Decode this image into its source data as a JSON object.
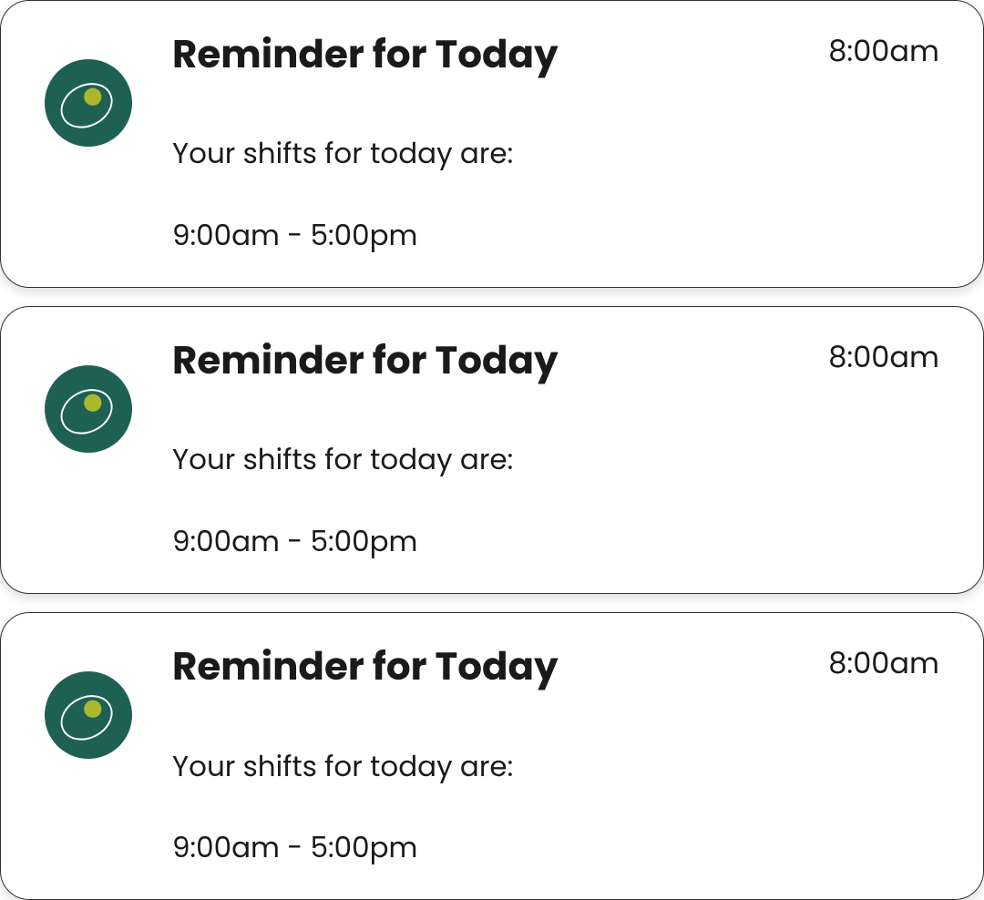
{
  "colors": {
    "icon_bg": "#1f5f55",
    "icon_accent": "#a9b92b",
    "icon_ring": "#ffffff"
  },
  "icon_svg": "<svg viewBox=\"0 0 100 100\"><circle cx=\"50\" cy=\"50\" r=\"50\" fill=\"#1f6055\"/><ellipse cx=\"48\" cy=\"53\" rx=\"30\" ry=\"23\" fill=\"none\" stroke=\"#ffffff\" stroke-width=\"2\" transform=\"rotate(-28 48 53)\"/><circle cx=\"55\" cy=\"43\" r=\"10\" fill=\"#a9b92b\"/></svg>",
  "notifications": [
    {
      "title": "Reminder for Today",
      "time": "8:00am",
      "body_line1": "Your shifts for today are:",
      "body_line2": "9:00am - 5:00pm"
    },
    {
      "title": "Reminder for Today",
      "time": "8:00am",
      "body_line1": "Your shifts for today are:",
      "body_line2": "9:00am - 5:00pm"
    },
    {
      "title": "Reminder for Today",
      "time": "8:00am",
      "body_line1": "Your shifts for today are:",
      "body_line2": "9:00am - 5:00pm"
    }
  ]
}
